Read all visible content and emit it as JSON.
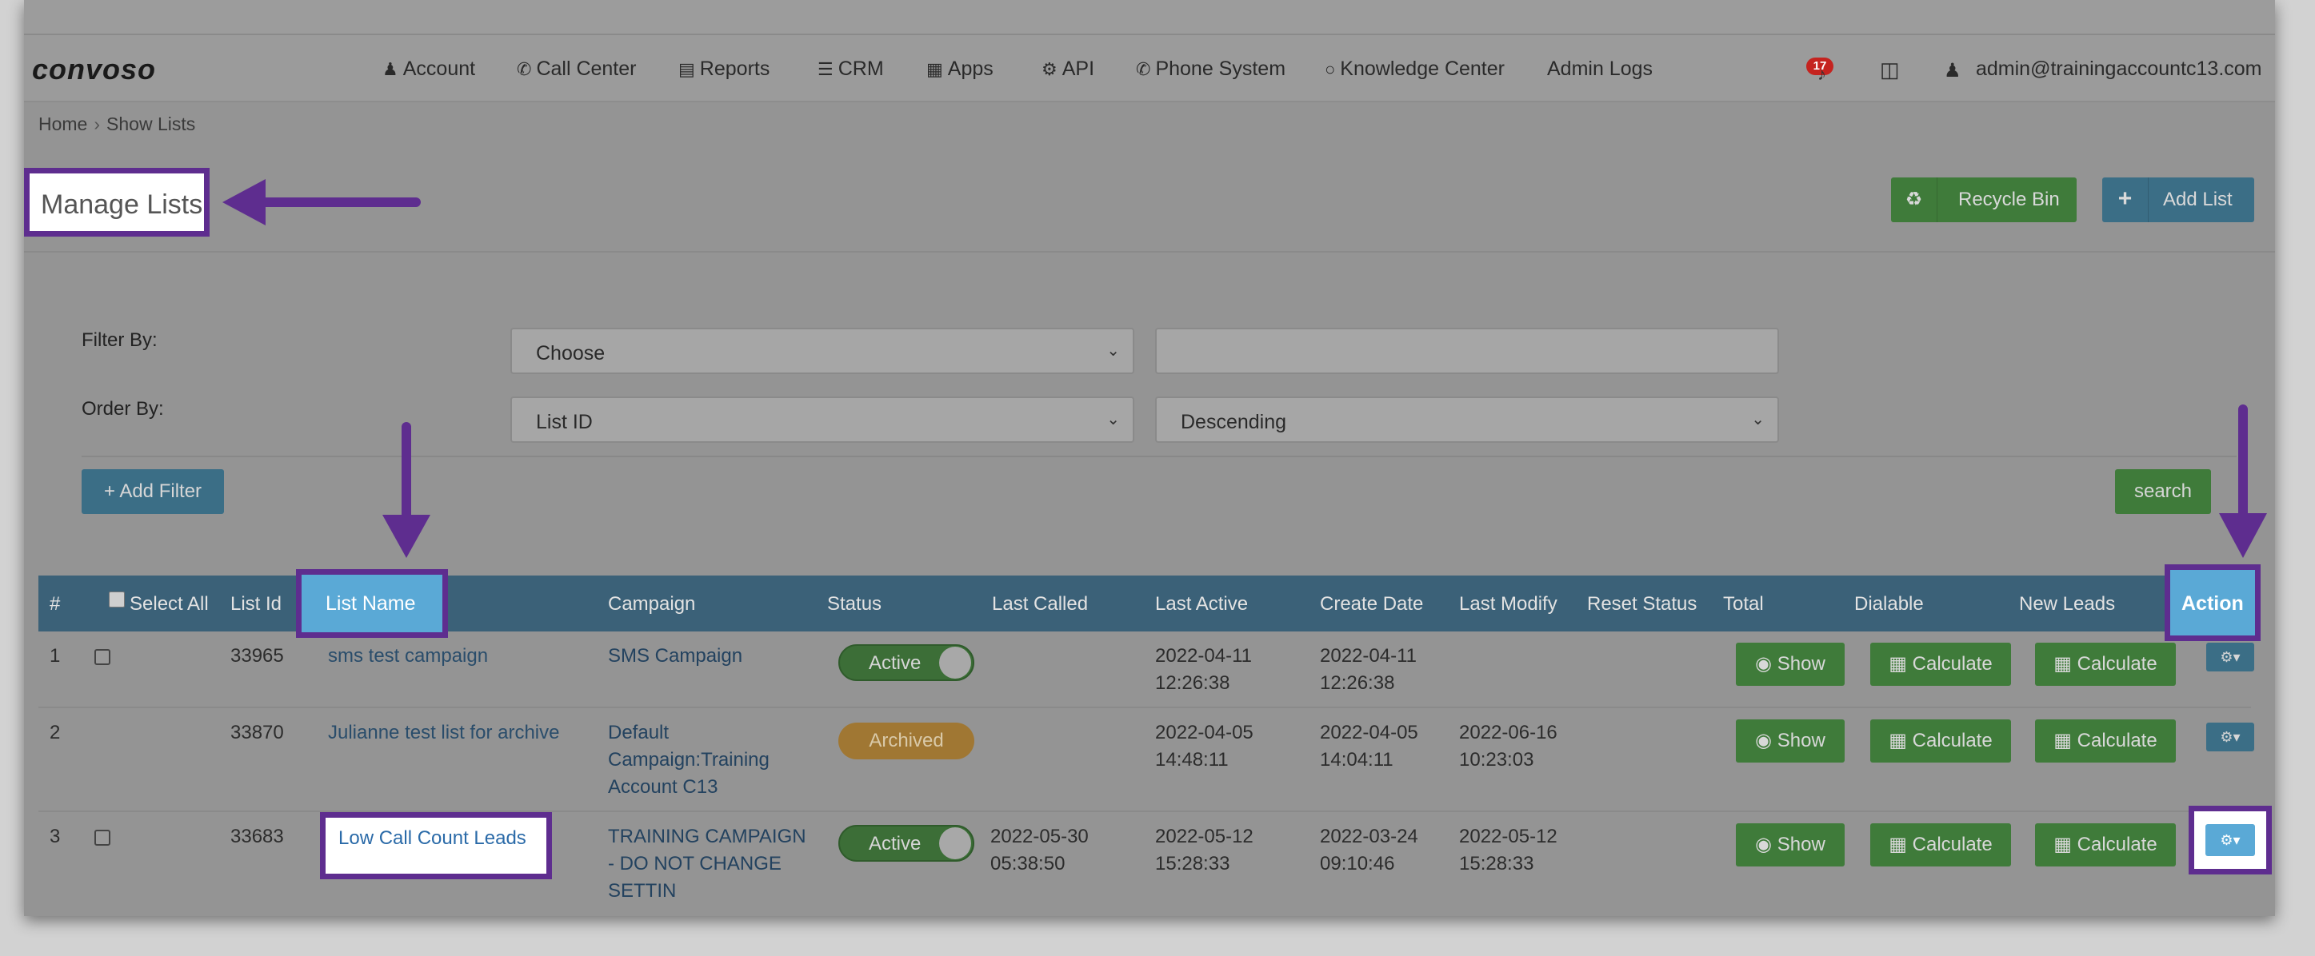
{
  "brand": {
    "logo": "convoso"
  },
  "nav": {
    "items": [
      {
        "icon": "user-icon",
        "label": "Account"
      },
      {
        "icon": "phone-icon",
        "label": "Call Center"
      },
      {
        "icon": "bar-chart-icon",
        "label": "Reports"
      },
      {
        "icon": "list-icon",
        "label": "CRM"
      },
      {
        "icon": "grid-icon",
        "label": "Apps"
      },
      {
        "icon": "gear-icon",
        "label": "API"
      },
      {
        "icon": "phone-icon",
        "label": "Phone System"
      },
      {
        "icon": "lightbulb-icon",
        "label": "Knowledge Center"
      },
      {
        "icon": "",
        "label": "Admin Logs"
      }
    ],
    "notifications_count": "17",
    "user_email": "admin@trainingaccountc13.com"
  },
  "breadcrumb": {
    "home": "Home",
    "current": "Show Lists"
  },
  "page": {
    "title": "Manage Lists",
    "recycle_bin_label": "Recycle Bin",
    "add_list_label": "Add List"
  },
  "filters": {
    "filter_by_label": "Filter By:",
    "filter_by_value": "Choose",
    "filter_text_value": "",
    "order_by_label": "Order By:",
    "order_by_value": "List ID",
    "order_direction_value": "Descending",
    "add_filter_label": "+ Add Filter",
    "search_label": "search"
  },
  "table": {
    "columns": [
      "#",
      "Select All",
      "List Id",
      "List Name",
      "Campaign",
      "Status",
      "Last Called",
      "Last Active",
      "Create Date",
      "Last Modify",
      "Reset Status",
      "Total",
      "Dialable",
      "New Leads",
      "Action"
    ],
    "rows": [
      {
        "num": "1",
        "list_id": "33965",
        "list_name": "sms test campaign",
        "campaign": [
          "SMS Campaign"
        ],
        "status": "Active",
        "last_called": [
          "",
          ""
        ],
        "last_active": [
          "2022-04-11",
          "12:26:38"
        ],
        "create_date": [
          "2022-04-11",
          "12:26:38"
        ],
        "last_modify": [
          "",
          ""
        ],
        "reset_status": "",
        "total_btn": "Show",
        "dialable_btn": "Calculate",
        "new_leads_btn": "Calculate"
      },
      {
        "num": "2",
        "list_id": "33870",
        "list_name": "Julianne test list for archive",
        "campaign": [
          "Default",
          "Campaign:Training",
          "Account C13"
        ],
        "status": "Archived",
        "last_called": [
          "",
          ""
        ],
        "last_active": [
          "2022-04-05",
          "14:48:11"
        ],
        "create_date": [
          "2022-04-05",
          "14:04:11"
        ],
        "last_modify": [
          "2022-06-16",
          "10:23:03"
        ],
        "reset_status": "",
        "total_btn": "Show",
        "dialable_btn": "Calculate",
        "new_leads_btn": "Calculate"
      },
      {
        "num": "3",
        "list_id": "33683",
        "list_name": "Low Call Count Leads",
        "campaign": [
          "TRAINING CAMPAIGN",
          "- DO NOT CHANGE",
          "SETTIN"
        ],
        "status": "Active",
        "last_called": [
          "2022-05-30",
          "05:38:50"
        ],
        "last_active": [
          "2022-05-12",
          "15:28:33"
        ],
        "create_date": [
          "2022-03-24",
          "09:10:46"
        ],
        "last_modify": [
          "2022-05-12",
          "15:28:33"
        ],
        "reset_status": "",
        "total_btn": "Show",
        "dialable_btn": "Calculate",
        "new_leads_btn": "Calculate"
      }
    ]
  },
  "colors": {
    "annotation_purple": "#5e2d8f",
    "highlight_blue": "#5aa9d6",
    "table_header": "#3b6178",
    "green_button": "#3f7b3a",
    "blue_button": "#3b6e86",
    "archived": "#a07733"
  }
}
